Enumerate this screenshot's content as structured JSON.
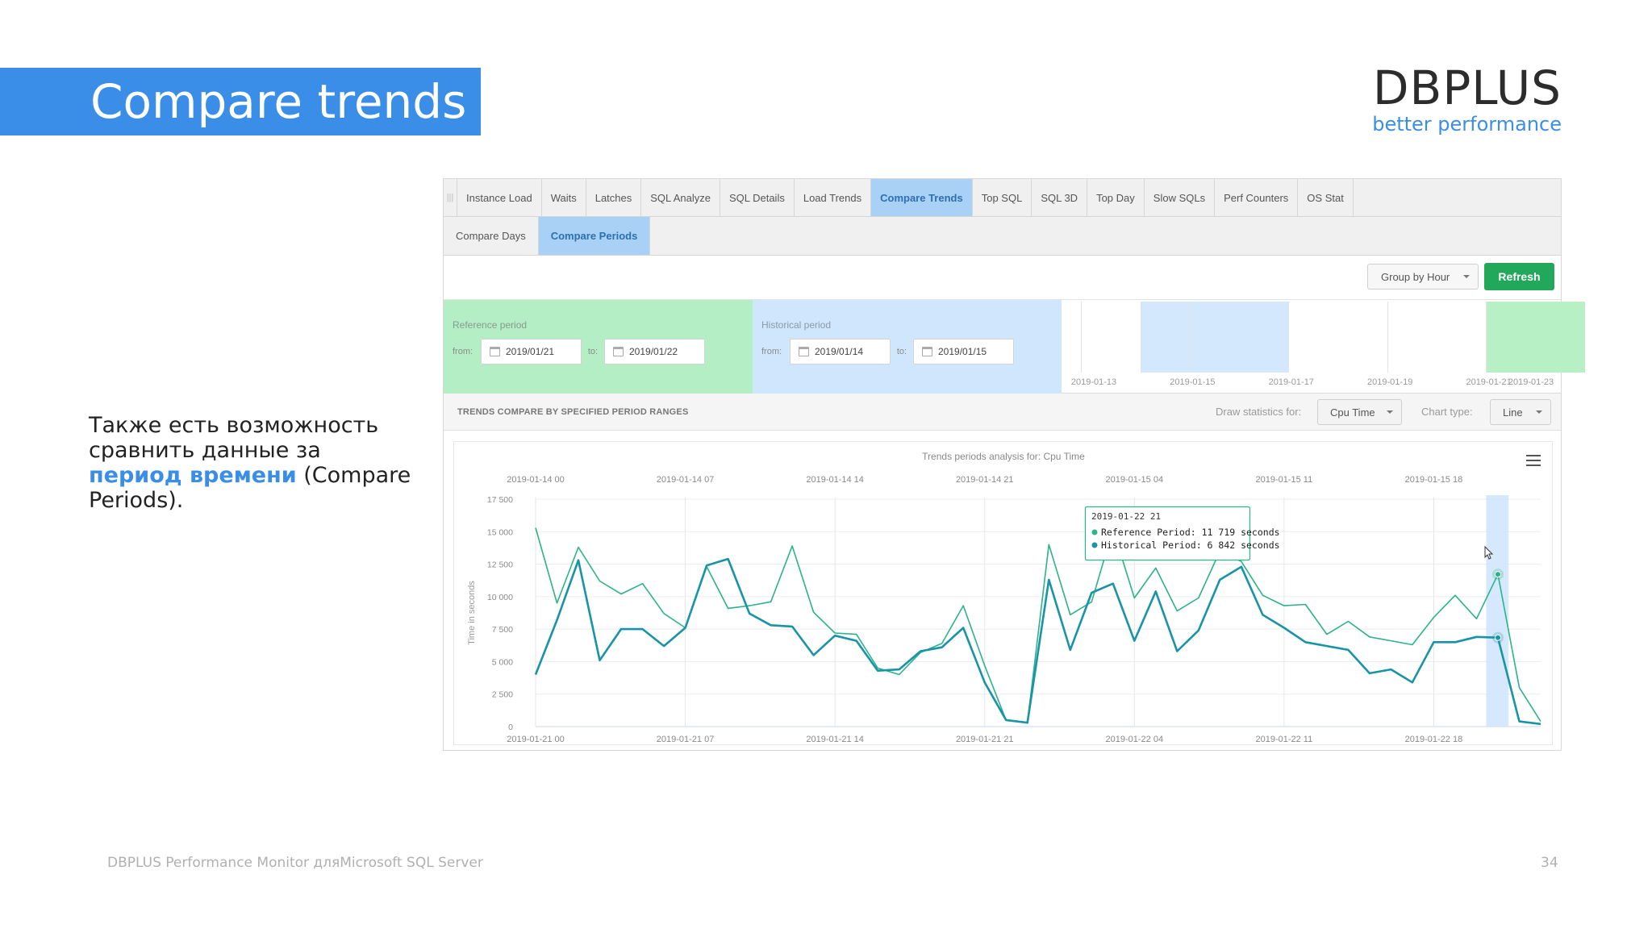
{
  "slide": {
    "title": "Compare trends",
    "logo_name": "DBPLUS",
    "logo_tagline": "better performance",
    "text_before": "Также есть возможность сравнить данные за ",
    "text_highlight": "период времени",
    "text_after": " (Compare Periods).",
    "footer_left": "DBPLUS Performance Monitor дляMicrosoft SQL Server",
    "footer_right": "34"
  },
  "app": {
    "tabs": [
      {
        "label": "Instance Load"
      },
      {
        "label": "Waits"
      },
      {
        "label": "Latches"
      },
      {
        "label": "SQL Analyze"
      },
      {
        "label": "SQL Details"
      },
      {
        "label": "Load Trends"
      },
      {
        "label": "Compare Trends",
        "active": true
      },
      {
        "label": "Top SQL"
      },
      {
        "label": "SQL 3D"
      },
      {
        "label": "Top Day"
      },
      {
        "label": "Slow SQLs"
      },
      {
        "label": "Perf Counters"
      },
      {
        "label": "OS Stat"
      }
    ],
    "subtabs": [
      {
        "label": "Compare Days"
      },
      {
        "label": "Compare Periods",
        "active": true
      }
    ],
    "group_by": "Group by Hour",
    "refresh": "Refresh",
    "reference": {
      "label": "Reference period",
      "from_label": "from:",
      "from": "2019/01/21",
      "to_label": "to:",
      "to": "2019/01/22"
    },
    "historical": {
      "label": "Historical period",
      "from_label": "from:",
      "from": "2019/01/14",
      "to_label": "to:",
      "to": "2019/01/15"
    },
    "timeline_labels": [
      "2019-01-13",
      "2019-01-15",
      "2019-01-17",
      "2019-01-19",
      "2019-01-21",
      "2019-01-23"
    ],
    "timeline_colors": {
      "reference": "#b7f0c5",
      "historical": "#d3e8fd"
    },
    "section_title": "TRENDS COMPARE BY SPECIFIED PERIOD RANGES",
    "draw_label": "Draw statistics for:",
    "draw_value": "Cpu Time",
    "chart_type_label": "Chart type:",
    "chart_type_value": "Line",
    "tooltip": {
      "date": "2019-01-22 21",
      "reference": "Reference Period: 11 719 seconds",
      "historical": "Historical Period: 6 842 seconds"
    }
  },
  "chart_data": {
    "type": "line",
    "title": "Trends periods analysis for: Cpu Time",
    "ylabel": "Time in seconds",
    "ylim": [
      0,
      17500
    ],
    "yticks": [
      0,
      2500,
      5000,
      7500,
      10000,
      12500,
      15000,
      17500
    ],
    "ytick_labels": [
      "0",
      "2 500",
      "5 000",
      "7 500",
      "10 000",
      "12 500",
      "15 000",
      "17 500"
    ],
    "x_top_labels": [
      "2019-01-14 00",
      "2019-01-14 07",
      "2019-01-14 14",
      "2019-01-14 21",
      "2019-01-15 04",
      "2019-01-15 11",
      "2019-01-15 18"
    ],
    "x_bottom_labels": [
      "2019-01-21 00",
      "2019-01-21 07",
      "2019-01-21 14",
      "2019-01-21 21",
      "2019-01-22 04",
      "2019-01-22 11",
      "2019-01-22 18"
    ],
    "highlight_index": 45,
    "series": [
      {
        "name": "Reference Period",
        "color": "#2bb38a",
        "values": [
          15300,
          9500,
          13800,
          11200,
          10200,
          11000,
          8700,
          7600,
          12300,
          9100,
          9300,
          9600,
          13900,
          8800,
          7200,
          7100,
          4500,
          4000,
          5700,
          6400,
          9300,
          4700,
          500,
          300,
          14000,
          8600,
          9600,
          15200,
          9900,
          12200,
          8900,
          9900,
          13500,
          12700,
          10100,
          9300,
          9400,
          7100,
          8100,
          6900,
          6600,
          6300,
          8400,
          10100,
          8300,
          11719,
          3000,
          400
        ]
      },
      {
        "name": "Historical Period",
        "color": "#1893a8",
        "values": [
          4000,
          8200,
          12800,
          5100,
          7500,
          7500,
          6200,
          7600,
          12400,
          12900,
          8700,
          7800,
          7700,
          5500,
          7000,
          6600,
          4300,
          4400,
          5800,
          6100,
          7600,
          3400,
          500,
          300,
          11300,
          5900,
          10300,
          11000,
          6600,
          10400,
          5800,
          7400,
          11300,
          12300,
          8600,
          7600,
          6500,
          6200,
          5900,
          4100,
          4400,
          3400,
          6500,
          6500,
          6900,
          6842,
          400,
          200
        ]
      }
    ]
  }
}
